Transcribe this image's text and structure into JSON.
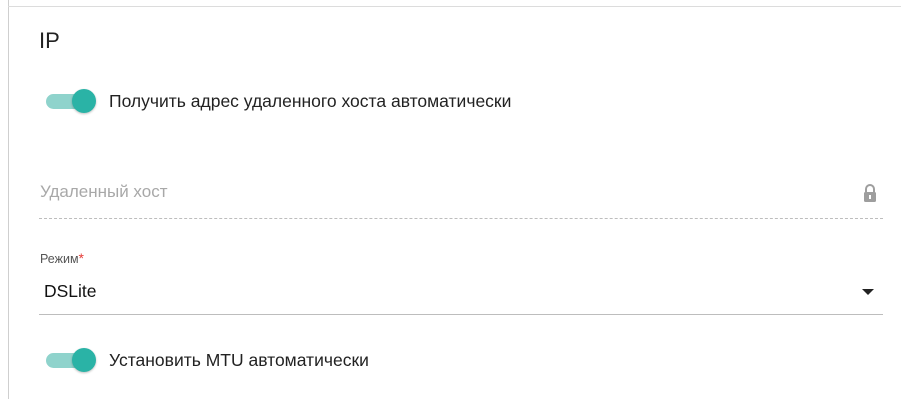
{
  "section": {
    "title": "IP"
  },
  "toggle_remote_host": {
    "label": "Получить адрес удаленного хоста автоматически",
    "state": "on"
  },
  "remote_host_field": {
    "placeholder": "Удаленный хост",
    "icon": "lock-icon",
    "disabled": true
  },
  "mode_field": {
    "label": "Режим",
    "required_mark": "*",
    "value": "DSLite",
    "icon": "caret-down-icon"
  },
  "toggle_mtu": {
    "label": "Установить MTU автоматически",
    "state": "on"
  },
  "colors": {
    "accent": "#2ab3a6",
    "accent_track": "#8fd3cc",
    "required": "#e53935"
  }
}
